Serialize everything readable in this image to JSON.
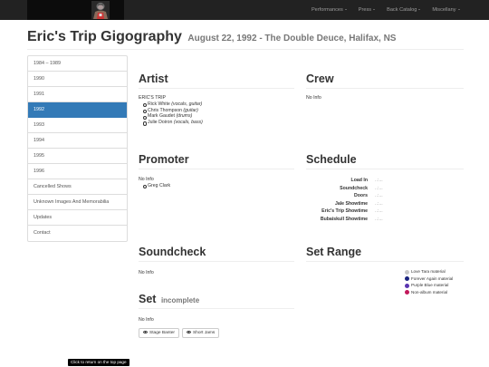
{
  "navbar": {
    "logo_icon": "band-photo-logo-icon",
    "menu": [
      {
        "label": "Performances"
      },
      {
        "label": "Press"
      },
      {
        "label": "Back Catalog"
      },
      {
        "label": "Miscellany"
      }
    ]
  },
  "header": {
    "title": "Eric's Trip Gigography",
    "subtitle": "August 22, 1992 - The Double Deuce, Halifax, NS"
  },
  "sidebar": {
    "items": [
      {
        "label": "1984 – 1989"
      },
      {
        "label": "1990"
      },
      {
        "label": "1991"
      },
      {
        "label": "1992",
        "active": true
      },
      {
        "label": "1993"
      },
      {
        "label": "1994"
      },
      {
        "label": "1995"
      },
      {
        "label": "1996"
      },
      {
        "label": "Cancelled Shows"
      },
      {
        "label": "Unknown Images And Memorabilia"
      },
      {
        "label": "Updates"
      },
      {
        "label": "Contact"
      }
    ]
  },
  "artist": {
    "heading": "Artist",
    "band": "ERIC'S TRIP",
    "members": [
      {
        "name": "Rick White",
        "role": "(vocals, guitar)"
      },
      {
        "name": "Chris Thompson",
        "role": "(guitar)"
      },
      {
        "name": "Mark Gaudet",
        "role": "(drums)"
      },
      {
        "name": "Julie Doiron",
        "role": "(vocals, bass)"
      }
    ]
  },
  "crew": {
    "heading": "Crew",
    "text": "No Info"
  },
  "promoter": {
    "heading": "Promoter",
    "text": "No Info",
    "people": [
      "Greg Clark"
    ]
  },
  "schedule": {
    "heading": "Schedule",
    "rows": [
      {
        "label": "Load In",
        "value": "..:..."
      },
      {
        "label": "Soundcheck",
        "value": "..:..."
      },
      {
        "label": "Doors",
        "value": "..:..."
      },
      {
        "label": "Jale Showtime",
        "value": "..:..."
      },
      {
        "label": "Eric's Trip Showtime",
        "value": "..:..."
      },
      {
        "label": "Bubaiskull Showtime",
        "value": "..:..."
      }
    ]
  },
  "soundcheck": {
    "heading": "Soundcheck",
    "text": "No Info"
  },
  "set_range": {
    "heading": "Set Range",
    "legend": [
      {
        "label": "Love Tara material",
        "color": "#c8c8c8"
      },
      {
        "label": "Forever Again material",
        "color": "#1a237e"
      },
      {
        "label": "Purple Blue material",
        "color": "#5a35b0"
      },
      {
        "label": "Non-album material",
        "color": "#c2185b"
      }
    ]
  },
  "set": {
    "heading": "Set",
    "status": "incomplete",
    "text": "No Info",
    "buttons": [
      {
        "label": "Stage Banter",
        "icon": "eye-icon"
      },
      {
        "label": "Short Jams",
        "icon": "eye-icon"
      }
    ]
  },
  "tooltip": {
    "text": "Click to return on the top page"
  }
}
